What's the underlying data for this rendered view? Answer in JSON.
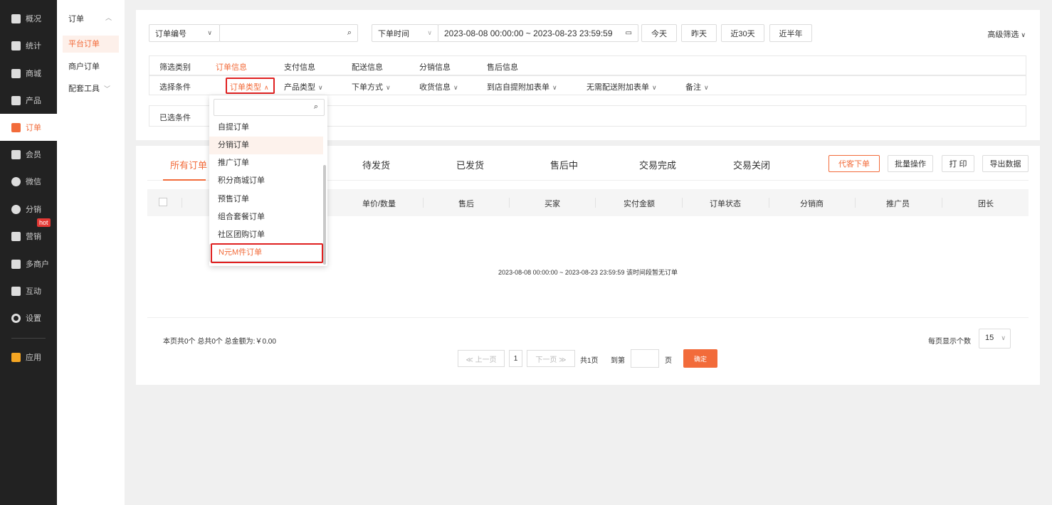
{
  "sidebar": {
    "items": [
      {
        "label": "概况",
        "icon": "layers-icon"
      },
      {
        "label": "统计",
        "icon": "chart-icon"
      },
      {
        "label": "商城",
        "icon": "store-icon"
      },
      {
        "label": "产品",
        "icon": "grid-icon"
      },
      {
        "label": "订单",
        "icon": "clipboard-icon",
        "active": true
      },
      {
        "label": "会员",
        "icon": "crown-icon"
      },
      {
        "label": "微信",
        "icon": "wechat-icon"
      },
      {
        "label": "分销",
        "icon": "users-icon"
      },
      {
        "label": "营销",
        "icon": "flag-icon",
        "badge": "hot"
      },
      {
        "label": "多商户",
        "icon": "shop-icon"
      },
      {
        "label": "互动",
        "icon": "apps-icon"
      },
      {
        "label": "设置",
        "icon": "gear-icon"
      },
      {
        "label": "应用",
        "icon": "app-grid-icon"
      }
    ]
  },
  "submenu": {
    "title": "订单",
    "items": [
      "平台订单",
      "商户订单",
      "配套工具"
    ]
  },
  "filters": {
    "search_field": "订单编号",
    "search_value": "",
    "time_field": "下单时间",
    "date_range": "2023-08-08 00:00:00 ~ 2023-08-23 23:59:59",
    "quick_ranges": [
      "今天",
      "昨天",
      "近30天",
      "近半年"
    ],
    "advanced": "高级筛选",
    "category_label": "筛选类别",
    "categories": [
      "订单信息",
      "支付信息",
      "配送信息",
      "分销信息",
      "售后信息"
    ],
    "condition_label": "选择条件",
    "conditions": [
      "订单类型",
      "产品类型",
      "下单方式",
      "收货信息",
      "到店自提附加表单",
      "无需配送附加表单",
      "备注"
    ],
    "selected_label": "已选条件"
  },
  "orders": {
    "tabs": [
      "所有订单",
      "待发货",
      "已发货",
      "售后中",
      "交易完成",
      "交易关闭"
    ],
    "actions": [
      "代客下单",
      "批量操作",
      "打 印",
      "导出数据"
    ],
    "columns": [
      "单价/数量",
      "售后",
      "买家",
      "实付金额",
      "订单状态",
      "分销商",
      "推广员",
      "团长"
    ],
    "empty_text": "2023-08-08 00:00:00 ~ 2023-08-23 23:59:59 该时间段暂无订单",
    "summary": "本页共0个  总共0个  总金额为:￥0.00",
    "per_page_label": "每页显示个数",
    "per_page": "15",
    "pagination": {
      "prev": "≪ 上一页",
      "page": "1",
      "next": "下一页 ≫",
      "total": "共1页",
      "goto": "到第",
      "unit": "页",
      "confirm": "确定"
    }
  },
  "dropdown": {
    "search_placeholder": "",
    "options": [
      "自提订单",
      "分销订单",
      "推广订单",
      "积分商城订单",
      "预售订单",
      "组合套餐订单",
      "社区团购订单",
      "N元M件订单"
    ]
  },
  "colors": {
    "accent": "#f26b3a",
    "highlight_box": "#e02020",
    "sidebar_bg": "#222222"
  }
}
